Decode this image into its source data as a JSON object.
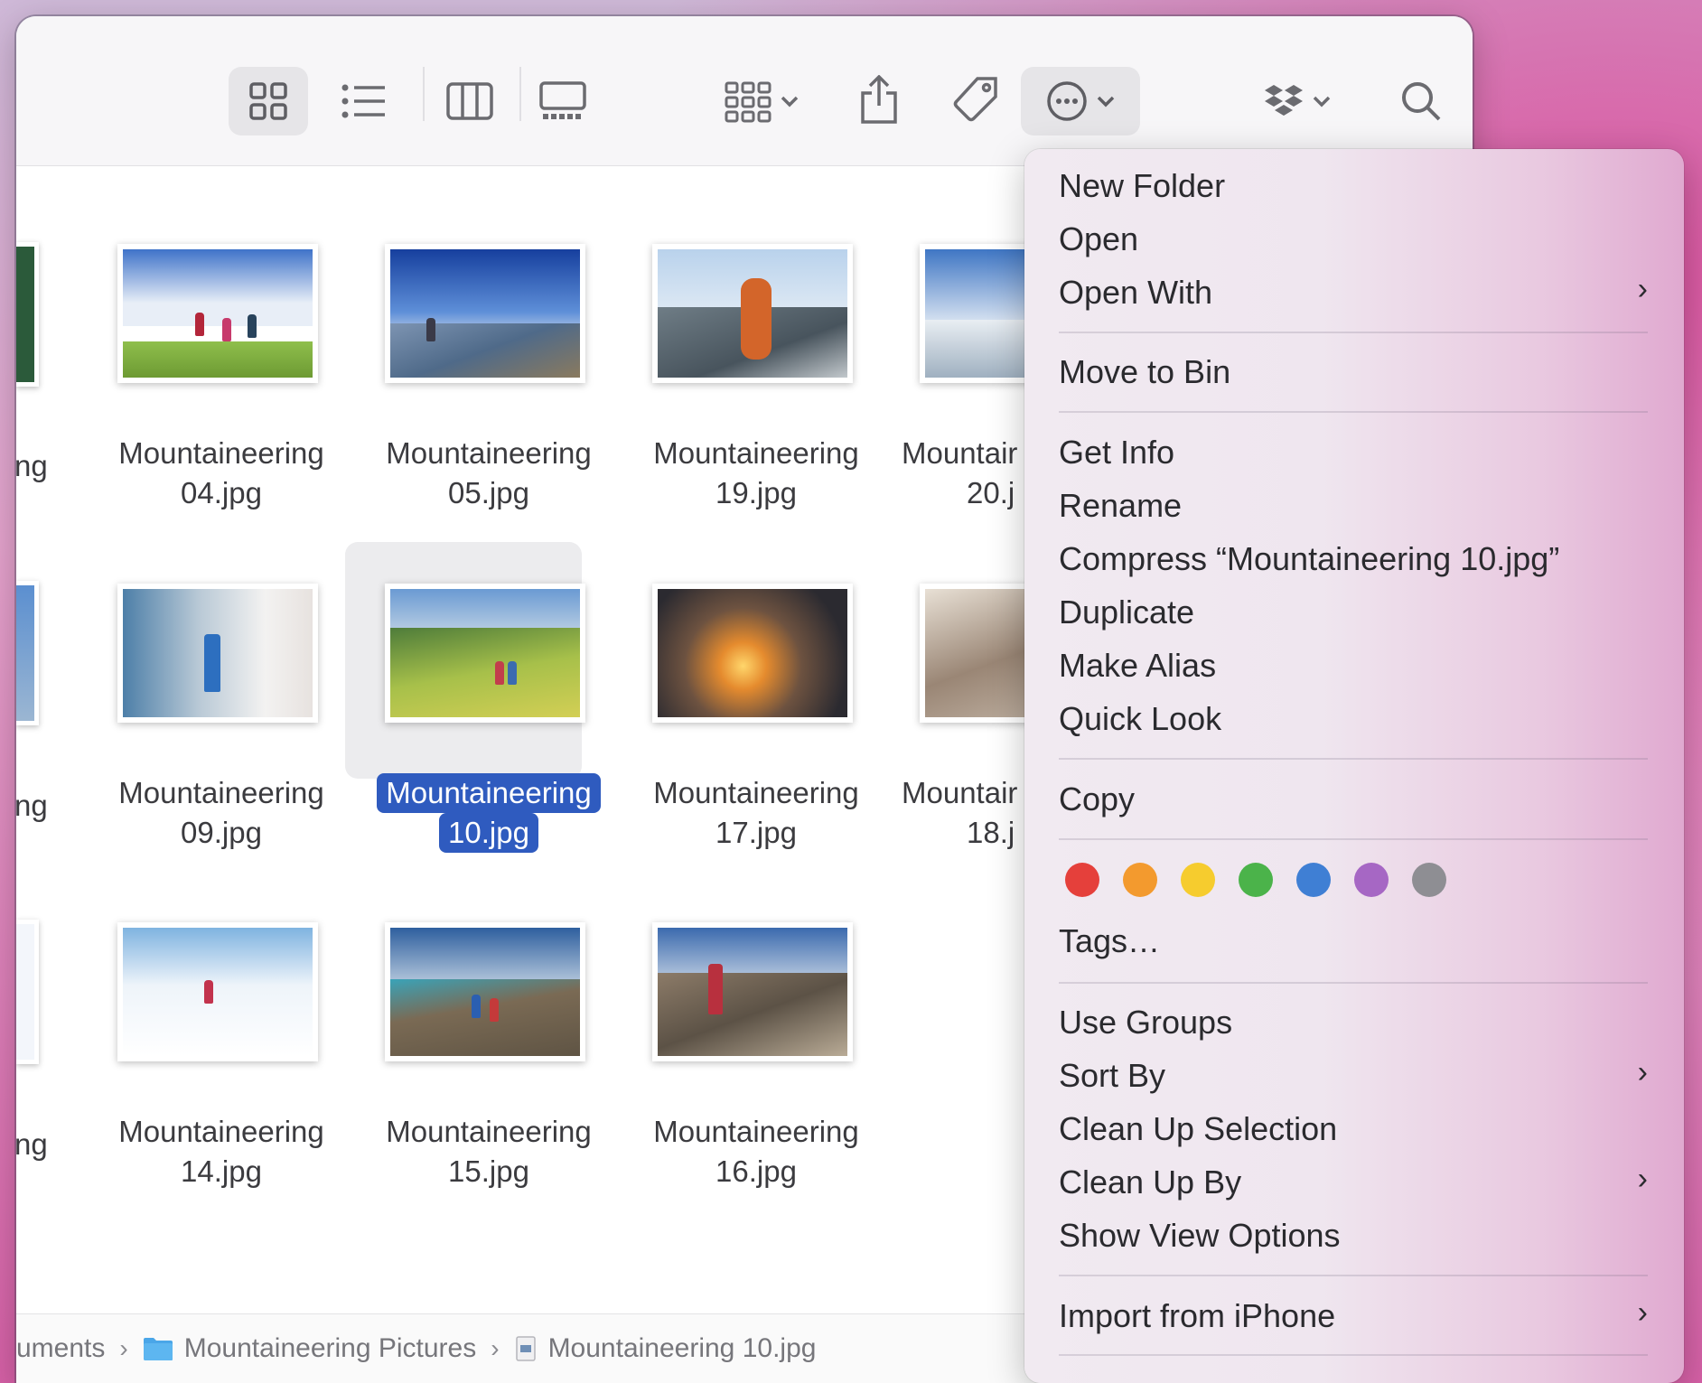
{
  "toolbar": {
    "view_buttons": [
      "icon-view",
      "list-view",
      "column-view",
      "gallery-view"
    ],
    "group_button": "group-by",
    "share_button": "share",
    "tag_button": "tags",
    "action_button": "more-actions",
    "dropbox_button": "dropbox",
    "search_button": "search"
  },
  "files": {
    "row1": [
      {
        "line1": "Mountaineering",
        "line2": "04.jpg"
      },
      {
        "line1": "Mountaineering",
        "line2": "05.jpg"
      },
      {
        "line1": "Mountaineering",
        "line2": "19.jpg"
      },
      {
        "line1": "Mountair",
        "line2": "20.j"
      }
    ],
    "row2": [
      {
        "line1": "Mountaineering",
        "line2": "09.jpg"
      },
      {
        "line1": "Mountaineering",
        "line2": "10.jpg"
      },
      {
        "line1": "Mountaineering",
        "line2": "17.jpg"
      },
      {
        "line1": "Mountair",
        "line2": "18.j"
      }
    ],
    "row3": [
      {
        "line1": "Mountaineering",
        "line2": "14.jpg"
      },
      {
        "line1": "Mountaineering",
        "line2": "15.jpg"
      },
      {
        "line1": "Mountaineering",
        "line2": "16.jpg"
      }
    ],
    "partial_left": "ng"
  },
  "pathbar": {
    "seg1": "uments",
    "seg2": "Mountaineering Pictures",
    "seg3": "Mountaineering 10.jpg",
    "sep": "›"
  },
  "menu": {
    "new_folder": "New Folder",
    "open": "Open",
    "open_with": "Open With",
    "move_to_bin": "Move to Bin",
    "get_info": "Get Info",
    "rename": "Rename",
    "compress": "Compress “Mountaineering 10.jpg”",
    "duplicate": "Duplicate",
    "make_alias": "Make Alias",
    "quick_look": "Quick Look",
    "copy": "Copy",
    "tags": "Tags…",
    "use_groups": "Use Groups",
    "sort_by": "Sort By",
    "clean_up_selection": "Clean Up Selection",
    "clean_up_by": "Clean Up By",
    "show_view_options": "Show View Options",
    "import_from_iphone": "Import from iPhone",
    "submenu_arrow": "›",
    "tag_colors": [
      "#e5403b",
      "#f39a2e",
      "#f6cc2e",
      "#4bb34a",
      "#3f7fd4",
      "#a667c4",
      "#8e8e93"
    ]
  }
}
